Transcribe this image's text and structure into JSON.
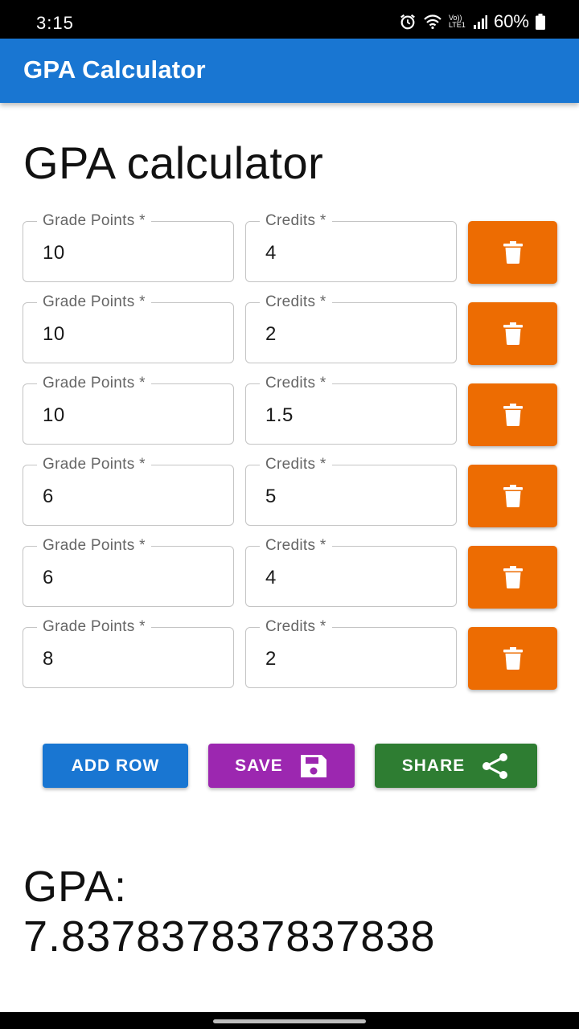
{
  "status_bar": {
    "time": "3:15",
    "network_label": "Vo)) LTE1",
    "battery": "60%"
  },
  "app_bar": {
    "title": "GPA Calculator"
  },
  "heading": "GPA calculator",
  "grade_label": "Grade Points *",
  "credits_label": "Credits *",
  "rows": [
    {
      "grade_points": "10",
      "credits": "4"
    },
    {
      "grade_points": "10",
      "credits": "2"
    },
    {
      "grade_points": "10",
      "credits": "1.5"
    },
    {
      "grade_points": "6",
      "credits": "5"
    },
    {
      "grade_points": "6",
      "credits": "4"
    },
    {
      "grade_points": "8",
      "credits": "2"
    }
  ],
  "actions": {
    "add_row": "ADD ROW",
    "save": "SAVE",
    "share": "SHARE"
  },
  "result": {
    "label": "GPA:",
    "value": "7.837837837837838"
  },
  "colors": {
    "primary": "#1976d2",
    "delete": "#ed6c02",
    "save": "#9c27b0",
    "share": "#2e7d32"
  }
}
